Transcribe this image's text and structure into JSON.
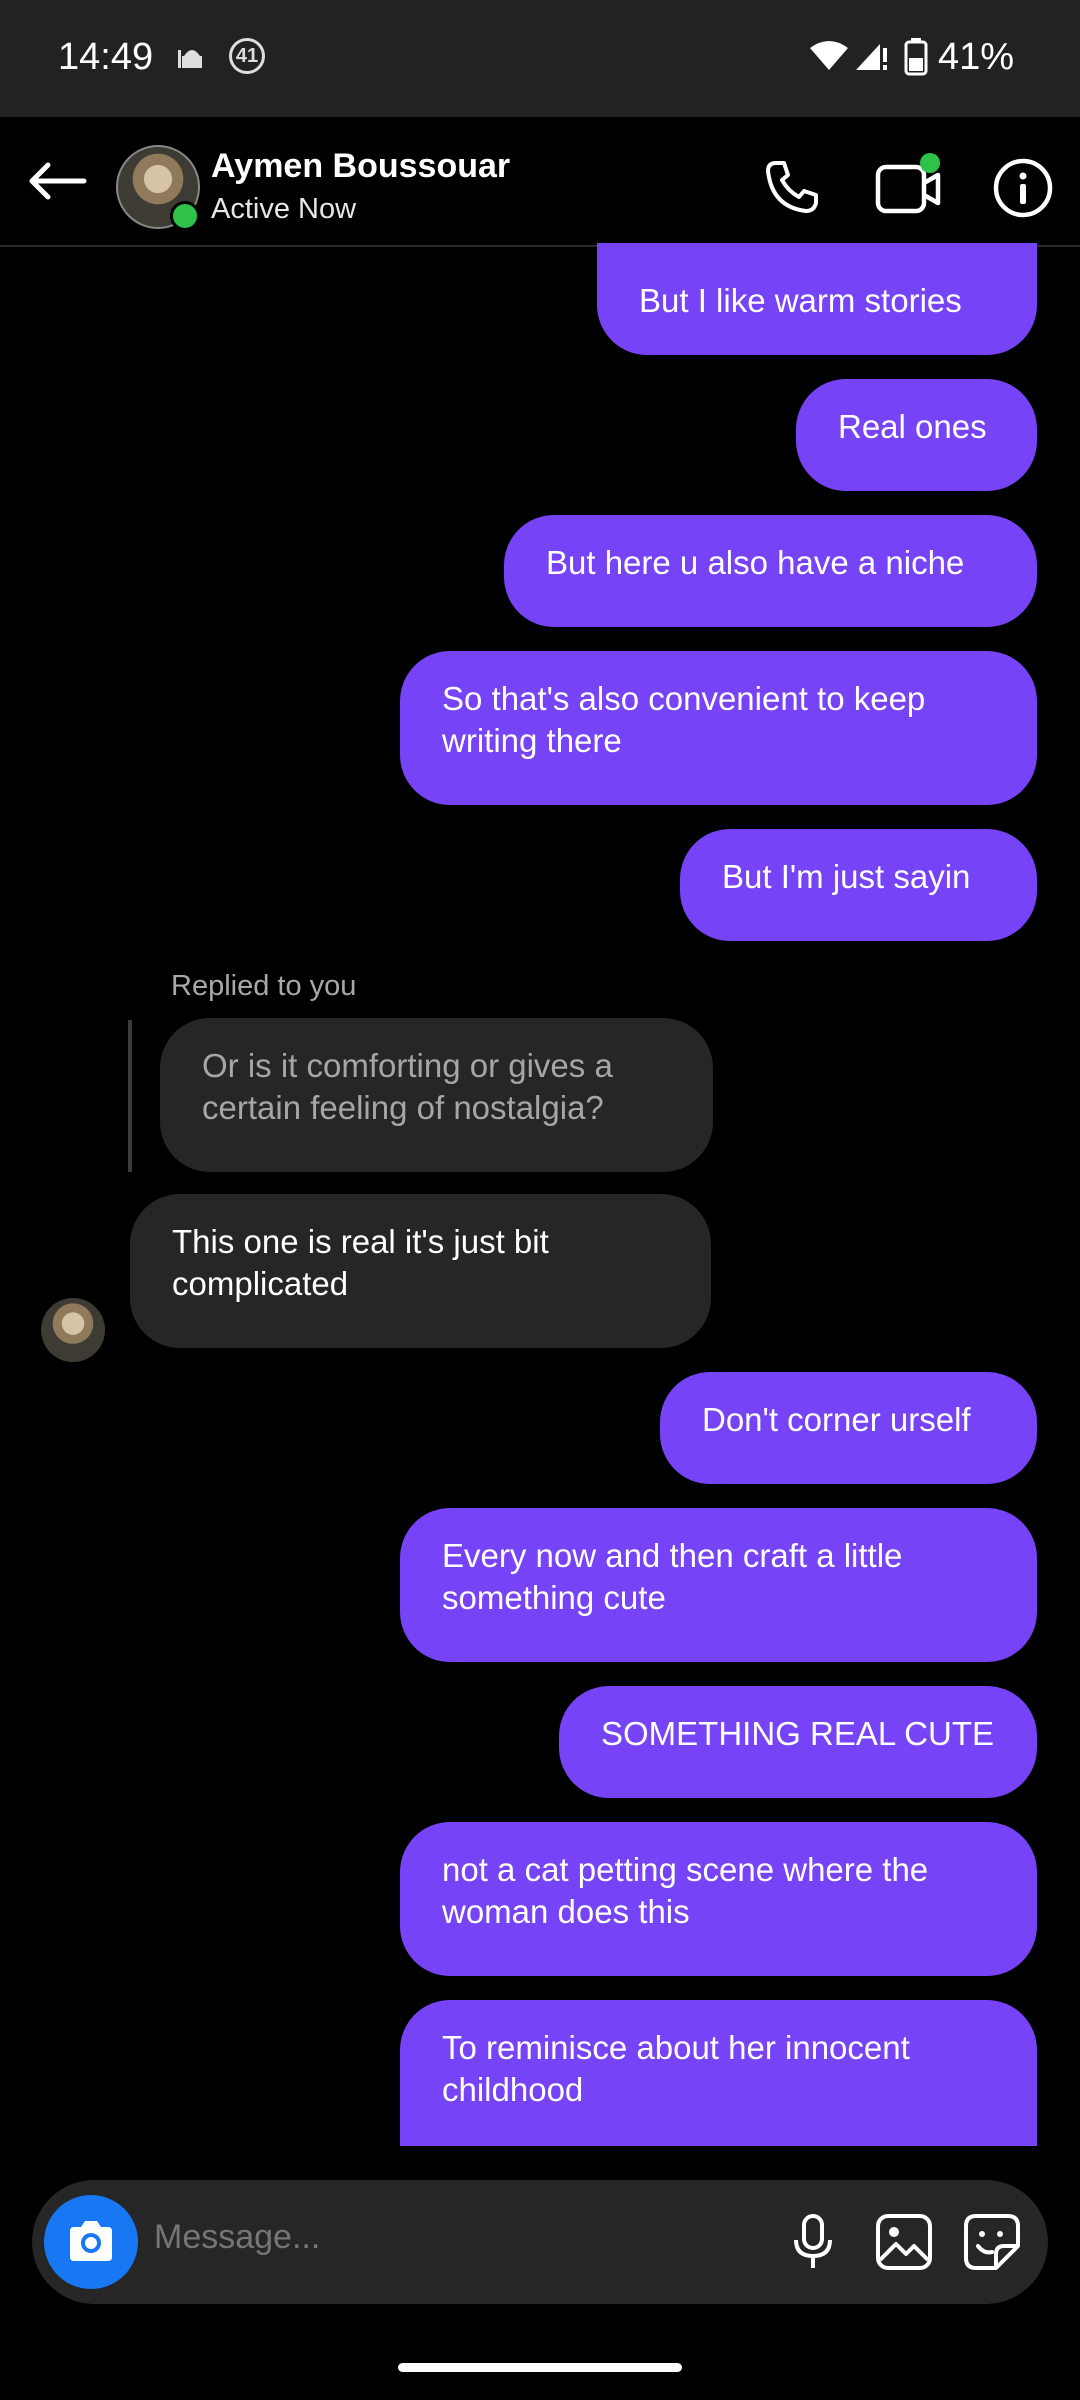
{
  "status_bar": {
    "time": "14:49",
    "notification_badge": "41",
    "battery_percent": "41%"
  },
  "header": {
    "contact_name": "Aymen Boussouar",
    "status": "Active Now",
    "icons": [
      "back-arrow-icon",
      "phone-icon",
      "video-call-icon",
      "info-icon"
    ],
    "video_dot_color": "#2ec24a"
  },
  "messages": [
    {
      "from": "me",
      "text": "But I like warm stories"
    },
    {
      "from": "me",
      "text": "Real ones"
    },
    {
      "from": "me",
      "text": "But here u also have a niche"
    },
    {
      "from": "me",
      "text": "So that's also convenient to keep writing there"
    },
    {
      "from": "me",
      "text": "But I'm just sayin"
    },
    {
      "from": "them",
      "reply_label": "Replied to you",
      "quoted": "Or is it comforting or gives a certain feeling of nostalgia?",
      "text": "This one is real it's just bit complicated"
    },
    {
      "from": "me",
      "text": "Don't corner urself"
    },
    {
      "from": "me",
      "text": "Every now and then craft a little something cute"
    },
    {
      "from": "me",
      "text": "SOMETHING REAL CUTE"
    },
    {
      "from": "me",
      "text": "not a cat petting scene where the woman does this"
    },
    {
      "from": "me",
      "text": "To reminisce about her innocent childhood"
    }
  ],
  "composer": {
    "placeholder": "Message...",
    "icons": [
      "camera-icon",
      "microphone-icon",
      "gallery-icon",
      "sticker-icon"
    ]
  },
  "colors": {
    "outgoing_bubble": "#7643f6",
    "incoming_bubble": "#262626",
    "camera_button": "#1877f2",
    "online": "#2ec24a"
  }
}
